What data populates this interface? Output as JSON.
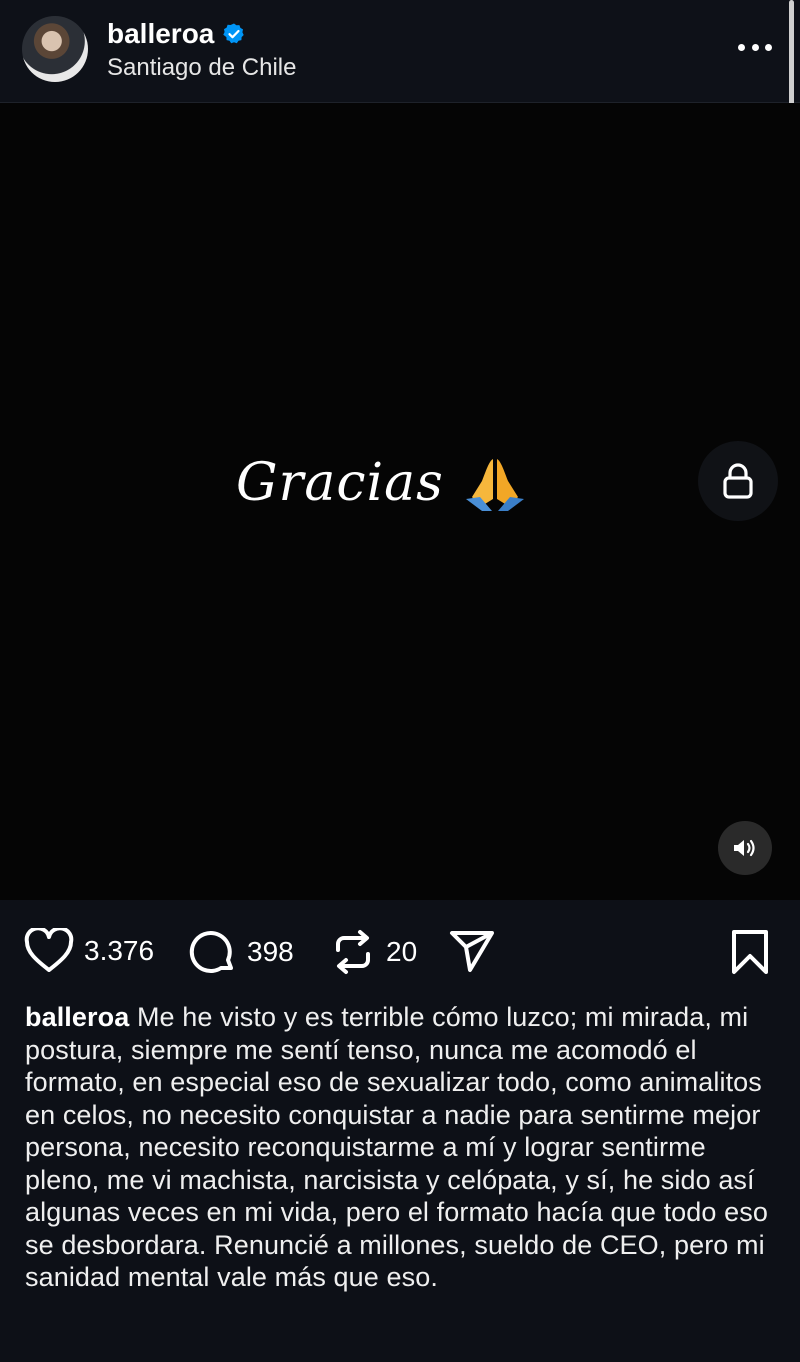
{
  "post": {
    "username": "balleroa",
    "location": "Santiago de Chile",
    "verified": true,
    "media_text": "Gracias",
    "media_emoji_icon": "folded-hands-icon"
  },
  "stats": {
    "likes": "3.376",
    "comments": "398",
    "reposts": "20"
  },
  "caption": {
    "username": "balleroa",
    "text": "Me he visto y es terrible cómo luzco; mi mirada, mi postura, siempre me sentí tenso, nunca me acomodó el formato, en especial eso de sexualizar todo, como animalitos en celos, no necesito conquistar a nadie para sentirme mejor persona, necesito reconquistarme a mí y lograr sentirme pleno, me vi machista, narcisista y celópata, y sí, he sido así algunas veces en mi vida, pero el formato hacía que todo eso se desbordara. Renuncié a millones, sueldo de CEO, pero mi sanidad mental vale más que eso."
  },
  "colors": {
    "background": "#0d1017",
    "media_background": "#050505",
    "verified_blue": "#0095f6",
    "text": "#f5f5f5"
  }
}
